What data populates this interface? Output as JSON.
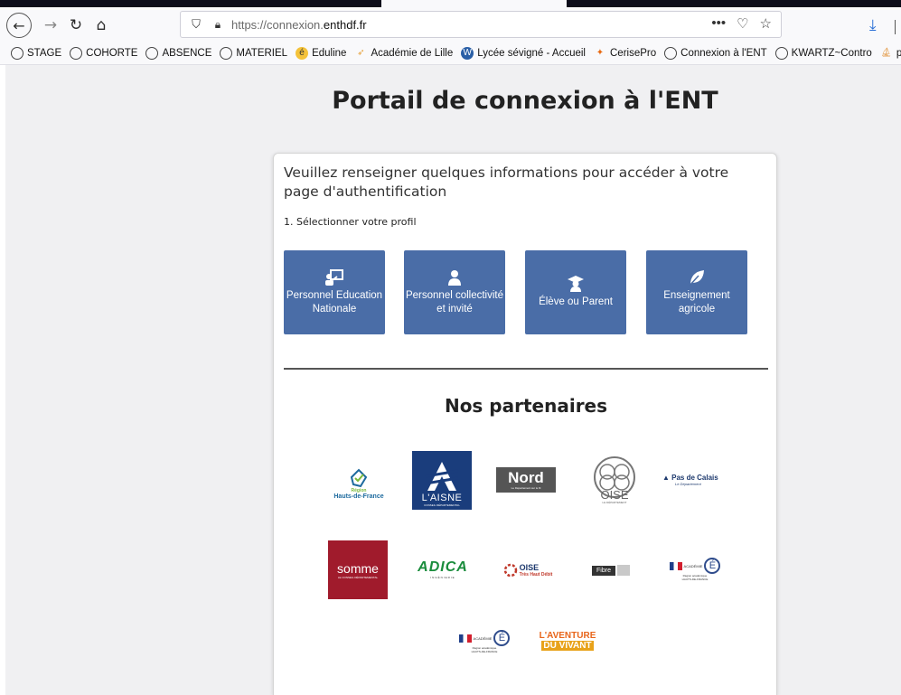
{
  "browser": {
    "url_prefix": "https://connexion.",
    "url_host": "enthdf.fr",
    "menu_dots": "•••"
  },
  "bookmarks": [
    {
      "label": "STAGE",
      "icon": "globe-icon"
    },
    {
      "label": "COHORTE",
      "icon": "globe-icon"
    },
    {
      "label": "ABSENCE",
      "icon": "globe-icon"
    },
    {
      "label": "MATERIEL",
      "icon": "globe-icon"
    },
    {
      "label": "Eduline",
      "icon": "eduline-icon"
    },
    {
      "label": "Académie de Lille",
      "icon": "academie-lille-icon"
    },
    {
      "label": "Lycée sévigné - Accueil",
      "icon": "wordpress-icon"
    },
    {
      "label": "CerisePro",
      "icon": "cerisepro-icon"
    },
    {
      "label": "Connexion à l'ENT",
      "icon": "globe-icon"
    },
    {
      "label": "KWARTZ~Contro",
      "icon": "globe-icon"
    },
    {
      "label": "phpMy",
      "icon": "phpmyadmin-icon"
    }
  ],
  "page": {
    "title": "Portail de connexion à l'ENT",
    "lead": "Veuillez renseigner quelques informations pour accéder à votre page d'authentification",
    "step": "1. Sélectionner votre profil",
    "profiles": [
      {
        "label": "Personnel Education Nationale",
        "icon": "teacher-board-icon"
      },
      {
        "label": "Personnel collectivité et invité",
        "icon": "user-group-icon"
      },
      {
        "label": "Élève ou Parent",
        "icon": "graduate-icon"
      },
      {
        "label": "Enseignement agricole",
        "icon": "leaf-icon"
      }
    ],
    "partners_title": "Nos partenaires"
  },
  "partners": {
    "hdf_line1": "Région",
    "hdf_line2": "Hauts-de-France",
    "aisne": "L'AISNE",
    "aisne_sub": "CONSEIL DÉPARTEMENTAL",
    "nord": "Nord",
    "nord_sub": "Le Département sur le fil",
    "oise": "OISE",
    "oise_sub": "LE DÉPARTEMENT",
    "pdc": "Pas de Calais",
    "pdc_sub": "Le Département",
    "somme": "somme",
    "somme_sub": "LE CONSEIL DÉPARTEMENTAL",
    "adica": "ADICA",
    "adica_sub": "INGÉNIERIE",
    "oise_thd": "OISE",
    "oise_thd_sub": "Très Haut Débit",
    "fibre": "Fibre",
    "academie": "ACADÉMIE",
    "region_acad": "Région académique",
    "region_acad2": "HAUTS-DE-FRANCE",
    "aventure1": "L'AVENTURE",
    "aventure2": "DU VIVANT"
  },
  "colors": {
    "profile_button": "#4a6da7",
    "somme_red": "#a01b2c",
    "aisne_blue": "#1a3d7c"
  }
}
